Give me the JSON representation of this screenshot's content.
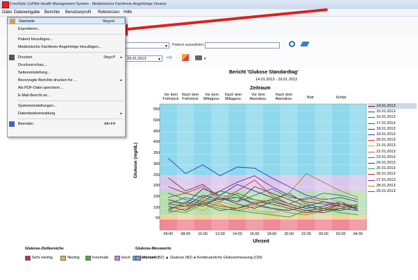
{
  "window": {
    "title": "FreeStyle CoPilot Health Management System - Medizinische Fachkreis-Angehörige Version"
  },
  "menubar": [
    "Datei",
    "Dateneingabe",
    "Berichte",
    "Benutzerprofil",
    "Referenzen",
    "Hilfe"
  ],
  "toolbar": {
    "patient_label": "Patient auswählen:",
    "date_value": "29.01.2013"
  },
  "file_menu": {
    "items": [
      {
        "label": "Startseite",
        "shortcut": "Strg+H",
        "icon": "home-icon"
      },
      {
        "label": "Exportieren...",
        "shortcut": ""
      },
      {
        "label": "Patient hinzufügen...",
        "shortcut": ""
      },
      {
        "label": "Medizinische Fachkreis-Angehörige hinzufügen...",
        "shortcut": ""
      },
      {
        "label": "Drucken",
        "shortcut": "Strg+P",
        "icon": "printer-icon",
        "submenu": true
      },
      {
        "label": "Druckvorschau...",
        "shortcut": ""
      },
      {
        "label": "Seiteneinstellung...",
        "shortcut": ""
      },
      {
        "label": "Bevorzugte Berichte drucken für ...",
        "shortcut": "",
        "submenu": true
      },
      {
        "label": "Als PDF-Datei speichern...",
        "shortcut": ""
      },
      {
        "label": "E-Mail-Bericht an...",
        "shortcut": ""
      },
      {
        "label": "Systemeinstellungen...",
        "shortcut": ""
      },
      {
        "label": "Datenbankverwaltung",
        "shortcut": "",
        "submenu": true
      },
      {
        "label": "Beenden",
        "shortcut": "Alt+F4",
        "icon": "exit-icon"
      }
    ]
  },
  "report": {
    "title": "Bericht 'Glukose Standardtag'",
    "date_range": "14.01.2013 - 29.01.2013",
    "period_label": "Zeitraum",
    "periods": [
      "Vor dem Frühstück",
      "Nach dem Frühstück",
      "Vor dem Mittagess.",
      "Nach dem Mittagess.",
      "Vor dem Abendess.",
      "Nach dem Abendess.",
      "Bett",
      "Schlaf"
    ]
  },
  "chart_data": {
    "type": "line",
    "title": "Bericht 'Glukose Standardtag'",
    "xlabel": "Uhrzeit",
    "ylabel": "Glukose (mg/dL)",
    "ylim": [
      0,
      580
    ],
    "yticks": [
      50,
      100,
      150,
      200,
      250,
      300,
      350,
      400,
      450,
      500,
      550
    ],
    "xticks": [
      "06:00",
      "08:00",
      "10:00",
      "12:00",
      "14:00",
      "16:00",
      "18:00",
      "20:00",
      "22:00",
      "00:00",
      "02:00",
      "04:00"
    ],
    "target_bands": [
      {
        "name": "Sehr niedrig",
        "from": 0,
        "to": 50,
        "color": "#f08a98"
      },
      {
        "name": "Niedrig",
        "from": 50,
        "to": 70,
        "color": "#f7cf9a"
      },
      {
        "name": "Innerhalb",
        "from": 70,
        "to": 180,
        "color": "#b4e0b0"
      },
      {
        "name": "Hoch",
        "from": 180,
        "to": 250,
        "color": "#d9c6ec"
      },
      {
        "name": "Sehr hoch",
        "from": 250,
        "to": 580,
        "color": "#8dd8ec"
      }
    ],
    "series": [
      {
        "name": "14.01.2013",
        "color": "#7a2a2a",
        "values": [
          240,
          180,
          210,
          150,
          130,
          200,
          170,
          140,
          110,
          90,
          120,
          100
        ]
      },
      {
        "name": "15.01.2013",
        "color": "#1f3b7a",
        "values": [
          140,
          120,
          190,
          160,
          210,
          180,
          150,
          120,
          100,
          110,
          130,
          90
        ]
      },
      {
        "name": "16.01.2013",
        "color": "#2a7a2a",
        "values": [
          110,
          90,
          150,
          130,
          170,
          140,
          120,
          100,
          80,
          90,
          100,
          120
        ]
      },
      {
        "name": "17.01.2013",
        "color": "#1a6a6a",
        "values": [
          120,
          150,
          130,
          180,
          160,
          120,
          140,
          170,
          120,
          100,
          90,
          110
        ]
      },
      {
        "name": "18.01.2013",
        "color": "#4a2a7a",
        "values": [
          90,
          130,
          110,
          150,
          120,
          100,
          130,
          110,
          90,
          80,
          100,
          90
        ]
      },
      {
        "name": "19.01.2013",
        "color": "#3333cc",
        "values": [
          330,
          260,
          300,
          250,
          290,
          285,
          240,
          200,
          160,
          140,
          150,
          130
        ]
      },
      {
        "name": "20.01.2013",
        "color": "#cc3333",
        "values": [
          150,
          170,
          200,
          140,
          180,
          230,
          160,
          120,
          150,
          130,
          110,
          100
        ]
      },
      {
        "name": "21.01.2013",
        "color": "#e0a020",
        "values": [
          100,
          120,
          90,
          130,
          110,
          90,
          80,
          100,
          120,
          150,
          130,
          110
        ]
      },
      {
        "name": "22.01.2013",
        "color": "#cc6633",
        "values": [
          80,
          100,
          140,
          120,
          90,
          110,
          100,
          80,
          70,
          90,
          110,
          100
        ]
      },
      {
        "name": "23.01.2013",
        "color": "#5555aa",
        "values": [
          170,
          140,
          120,
          150,
          130,
          160,
          190,
          150,
          140,
          170,
          160,
          140
        ]
      },
      {
        "name": "24.01.2013",
        "color": "#333399",
        "values": [
          120,
          110,
          160,
          140,
          150,
          120,
          100,
          90,
          110,
          130,
          120,
          100
        ]
      },
      {
        "name": "25.01.2013",
        "color": "#2aa02a",
        "values": [
          90,
          80,
          120,
          100,
          90,
          80,
          70,
          60,
          90,
          100,
          80,
          70
        ]
      },
      {
        "name": "26.01.2013",
        "color": "#aa2222",
        "values": [
          110,
          90,
          130,
          110,
          100,
          120,
          140,
          110,
          90,
          100,
          120,
          110
        ]
      },
      {
        "name": "27.01.2013",
        "color": "#882288",
        "values": [
          200,
          170,
          150,
          180,
          220,
          250,
          200,
          160,
          130,
          120,
          110,
          100
        ]
      },
      {
        "name": "28.01.2013",
        "color": "#aa7733",
        "values": [
          130,
          120,
          110,
          160,
          150,
          140,
          130,
          170,
          260,
          220,
          180,
          150
        ]
      },
      {
        "name": "29.01.2013",
        "color": "#7a5522",
        "values": [
          100,
          110,
          120,
          90,
          100,
          130,
          120,
          100,
          80,
          90,
          100,
          90
        ]
      }
    ]
  },
  "legend_bottom": {
    "target_title": "Glukose-Zielbereiche",
    "target_items": [
      "Sehr niedrig",
      "Niedrig",
      "Innerhalb",
      "Hoch",
      "Sehr hoch"
    ],
    "target_colors": [
      "#d8263d",
      "#f2b233",
      "#3fb43f",
      "#b88be0",
      "#2bbbe0"
    ],
    "measure_title": "Glukose-Messwerte",
    "measure_text": "Manuell (BZ) ▲ Glukose (BZ) ● Kontinuierliche Glukosemessung (CM)"
  }
}
